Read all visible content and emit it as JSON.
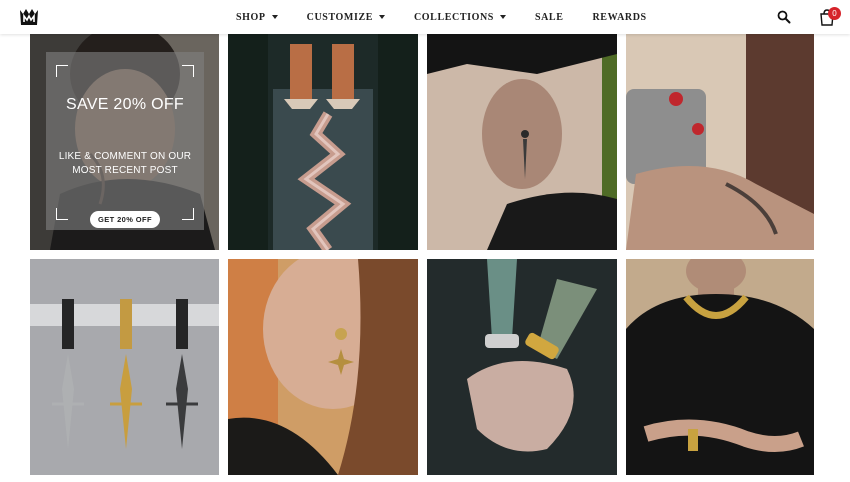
{
  "header": {
    "logo_icon": "crown-m-logo",
    "nav": [
      {
        "label": "SHOP",
        "has_dropdown": true
      },
      {
        "label": "CUSTOMIZE",
        "has_dropdown": true
      },
      {
        "label": "COLLECTIONS",
        "has_dropdown": true
      },
      {
        "label": "SALE",
        "has_dropdown": false
      },
      {
        "label": "REWARDS",
        "has_dropdown": false
      }
    ],
    "search_icon": "search-icon",
    "cart_icon": "shopping-bag-icon",
    "cart_count": "0",
    "badge_color": "#d6232a"
  },
  "promo": {
    "title": "SAVE 20% OFF",
    "subtitle": "LIKE & COMMENT ON OUR MOST RECENT POST",
    "button_label": "GET 20% OFF"
  },
  "gallery": [
    {
      "id": "portrait-tattooed-man"
    },
    {
      "id": "temple-zigzag-bridge"
    },
    {
      "id": "man-dagger-earring"
    },
    {
      "id": "hands-game-controller"
    },
    {
      "id": "dagger-earrings-rail"
    },
    {
      "id": "woman-star-earring"
    },
    {
      "id": "tattooed-wrists-bracelets"
    },
    {
      "id": "man-gold-chain"
    }
  ]
}
